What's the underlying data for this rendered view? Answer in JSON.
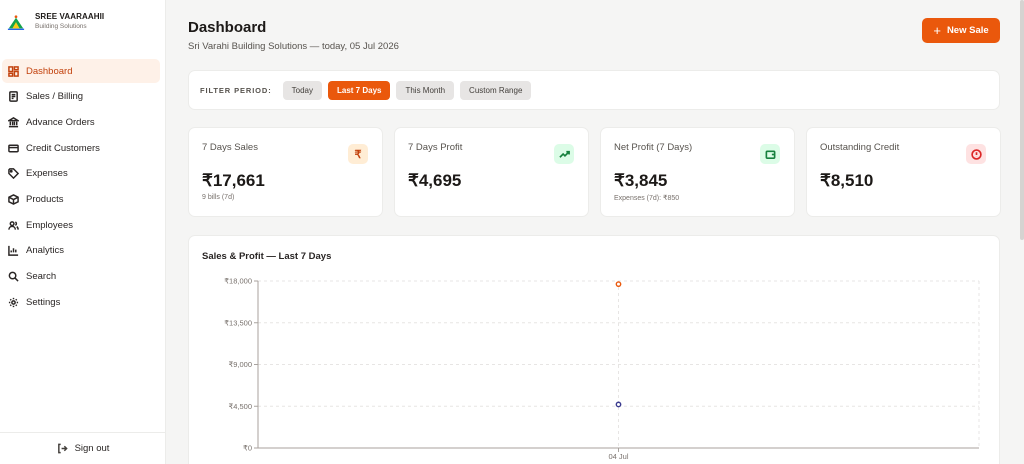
{
  "brand": {
    "name": "SREE VAARAAHII",
    "subtitle": "Building Solutions",
    "logo_icon": "house-logo-icon"
  },
  "sidebar": {
    "items": [
      {
        "label": "Dashboard",
        "icon": "dashboard-icon",
        "active": true
      },
      {
        "label": "Sales / Billing",
        "icon": "receipt-icon",
        "active": false
      },
      {
        "label": "Advance Orders",
        "icon": "bank-icon",
        "active": false
      },
      {
        "label": "Credit Customers",
        "icon": "credit-card-icon",
        "active": false
      },
      {
        "label": "Expenses",
        "icon": "tag-icon",
        "active": false
      },
      {
        "label": "Products",
        "icon": "package-icon",
        "active": false
      },
      {
        "label": "Employees",
        "icon": "users-icon",
        "active": false
      },
      {
        "label": "Analytics",
        "icon": "bar-chart-icon",
        "active": false
      },
      {
        "label": "Search",
        "icon": "search-icon",
        "active": false
      },
      {
        "label": "Settings",
        "icon": "gear-icon",
        "active": false
      }
    ],
    "signout_label": "Sign out"
  },
  "header": {
    "title": "Dashboard",
    "subtitle": "Sri Varahi Building Solutions — today, 05 Jul 2026",
    "new_sale_label": "New Sale",
    "new_sale_glyph": "+"
  },
  "filter": {
    "label": "FILTER PERIOD:",
    "options": [
      {
        "label": "Today",
        "active": false
      },
      {
        "label": "Last 7 Days",
        "active": true
      },
      {
        "label": "This Month",
        "active": false
      },
      {
        "label": "Custom Range",
        "active": false
      }
    ]
  },
  "stats": [
    {
      "label": "7 Days Sales",
      "value": "₹17,661",
      "note": "9 bills (7d)",
      "icon": "rupee-icon",
      "glyph": "₹",
      "icon_color": "#c2410c",
      "icon_bg": "#ffedd5"
    },
    {
      "label": "7 Days Profit",
      "value": "₹4,695",
      "note": "",
      "icon": "trending-up-icon",
      "glyph": "",
      "icon_color": "#15803d",
      "icon_bg": "#dcfce7"
    },
    {
      "label": "Net Profit (7 Days)",
      "value": "₹3,845",
      "note": "Expenses (7d): ₹850",
      "icon": "wallet-icon",
      "glyph": "",
      "icon_color": "#15803d",
      "icon_bg": "#dcfce7"
    },
    {
      "label": "Outstanding Credit",
      "value": "₹8,510",
      "note": "",
      "icon": "alert-circle-icon",
      "glyph": "",
      "icon_color": "#dc2626",
      "icon_bg": "#fee2e2"
    }
  ],
  "chart_data": {
    "type": "line",
    "title": "Sales & Profit — Last 7 Days",
    "x": [
      "04 Jul"
    ],
    "y_ticks": [
      "₹0",
      "₹4,500",
      "₹9,000",
      "₹13,500",
      "₹18,000"
    ],
    "ylim": [
      0,
      18000
    ],
    "grid": true,
    "series": [
      {
        "values": [
          17661
        ],
        "color": "#ea580c"
      },
      {
        "values": [
          4695
        ],
        "color": "#3b3b8f"
      }
    ]
  }
}
